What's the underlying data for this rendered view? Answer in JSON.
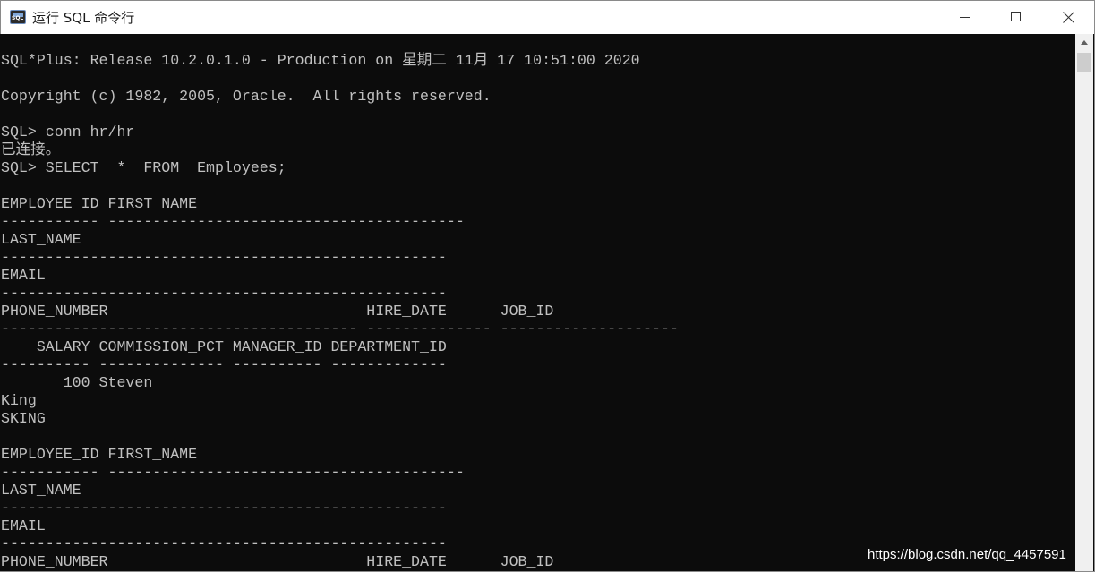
{
  "window": {
    "title": "运行 SQL 命令行"
  },
  "console": {
    "text": "SQL*Plus: Release 10.2.0.1.0 - Production on 星期二 11月 17 10:51:00 2020\n\nCopyright (c) 1982, 2005, Oracle.  All rights reserved.\n\nSQL> conn hr/hr\n已连接。\nSQL> SELECT  *  FROM  Employees;\n\nEMPLOYEE_ID FIRST_NAME\n----------- ----------------------------------------\nLAST_NAME\n--------------------------------------------------\nEMAIL\n--------------------------------------------------\nPHONE_NUMBER                             HIRE_DATE      JOB_ID\n---------------------------------------- -------------- --------------------\n    SALARY COMMISSION_PCT MANAGER_ID DEPARTMENT_ID\n---------- -------------- ---------- -------------\n       100 Steven\nKing\nSKING\n\nEMPLOYEE_ID FIRST_NAME\n----------- ----------------------------------------\nLAST_NAME\n--------------------------------------------------\nEMAIL\n--------------------------------------------------\nPHONE_NUMBER                             HIRE_DATE      JOB_ID"
  },
  "watermark": "https://blog.csdn.net/qq_4457591",
  "icons": {
    "app": "sqlplus-app-icon",
    "minimize": "minimize-icon",
    "maximize": "maximize-icon",
    "close": "close-icon",
    "scroll_up": "scroll-up-arrow-icon"
  },
  "colors": {
    "console_bg": "#0c0c0c",
    "console_fg": "#c0c0c0",
    "titlebar_bg": "#ffffff"
  }
}
